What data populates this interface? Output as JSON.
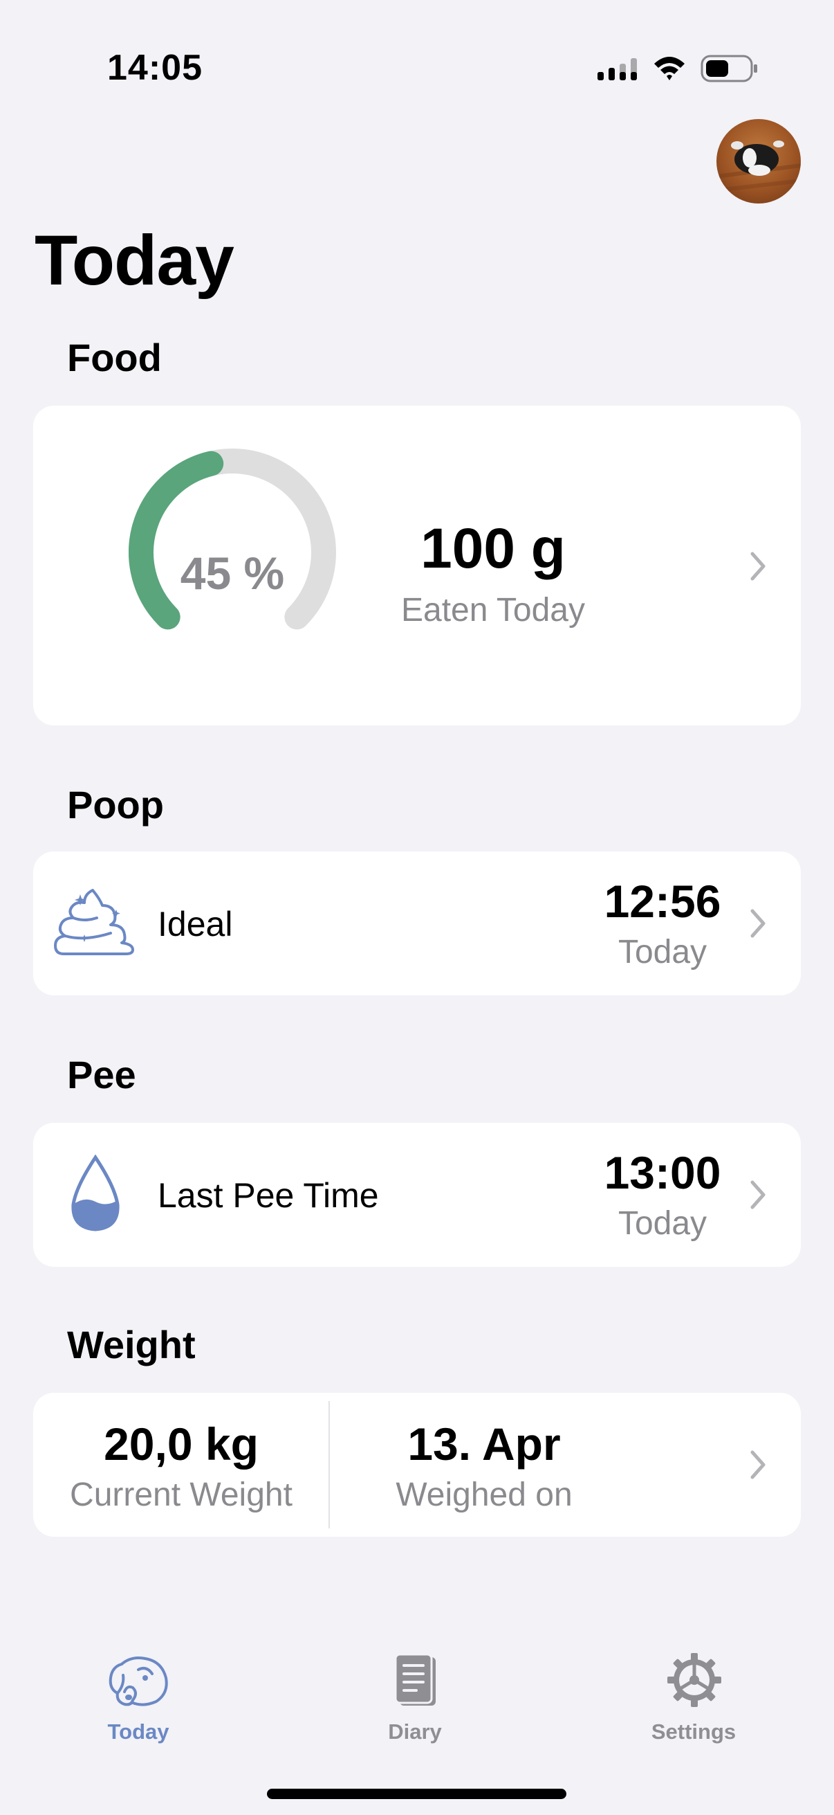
{
  "status_bar": {
    "time": "14:05",
    "icons": [
      "signal-icon",
      "wifi-icon",
      "battery-icon"
    ]
  },
  "header": {
    "title": "Today",
    "avatar": "dog-avatar"
  },
  "food": {
    "section_title": "Food",
    "progress_label": "45 %",
    "progress_fraction": 0.45,
    "amount": "100 g",
    "amount_caption": "Eaten Today"
  },
  "poop": {
    "section_title": "Poop",
    "status": "Ideal",
    "time": "12:56",
    "day": "Today",
    "icon": "poop-icon"
  },
  "pee": {
    "section_title": "Pee",
    "label": "Last Pee Time",
    "time": "13:00",
    "day": "Today",
    "icon": "water-drop-icon"
  },
  "weight": {
    "section_title": "Weight",
    "value": "20,0 kg",
    "value_caption": "Current Weight",
    "date": "13. Apr",
    "date_caption": "Weighed on"
  },
  "tab_bar": {
    "tabs": [
      {
        "label": "Today",
        "icon": "dog-head-icon",
        "active": true
      },
      {
        "label": "Diary",
        "icon": "notebook-icon",
        "active": false
      },
      {
        "label": "Settings",
        "icon": "gear-icon",
        "active": false
      }
    ]
  },
  "colors": {
    "accent": "#6b88c4",
    "progress": "#5aa57c",
    "track": "#dedede",
    "secondary_text": "#8a8a8e",
    "background": "#f2f2f7"
  }
}
